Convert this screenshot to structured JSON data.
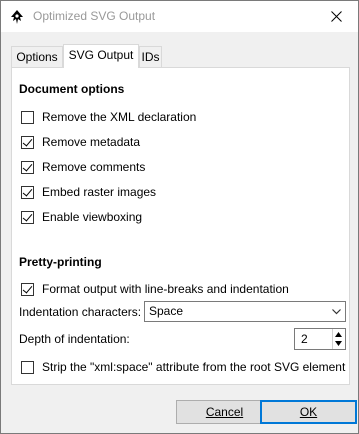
{
  "window": {
    "title": "Optimized SVG Output",
    "icon": "inkscape-icon",
    "close_icon": "close-icon"
  },
  "tabs": [
    {
      "label": "Options",
      "active": false
    },
    {
      "label": "SVG Output",
      "active": true
    },
    {
      "label": "IDs",
      "active": false
    }
  ],
  "document_options": {
    "title": "Document options",
    "items": [
      {
        "label": "Remove the XML declaration",
        "checked": false
      },
      {
        "label": "Remove metadata",
        "checked": true
      },
      {
        "label": "Remove comments",
        "checked": true
      },
      {
        "label": "Embed raster images",
        "checked": true
      },
      {
        "label": "Enable viewboxing",
        "checked": true
      }
    ]
  },
  "pretty_printing": {
    "title": "Pretty-printing",
    "format_label": "Format output with line-breaks and indentation",
    "format_checked": true,
    "indent_chars_label": "Indentation characters:",
    "indent_chars_value": "Space",
    "indent_depth_label": "Depth of indentation:",
    "indent_depth_value": "2",
    "strip_label": "Strip the \"xml:space\" attribute from the root SVG element",
    "strip_checked": false
  },
  "buttons": {
    "cancel": "Cancel",
    "ok": "OK"
  }
}
